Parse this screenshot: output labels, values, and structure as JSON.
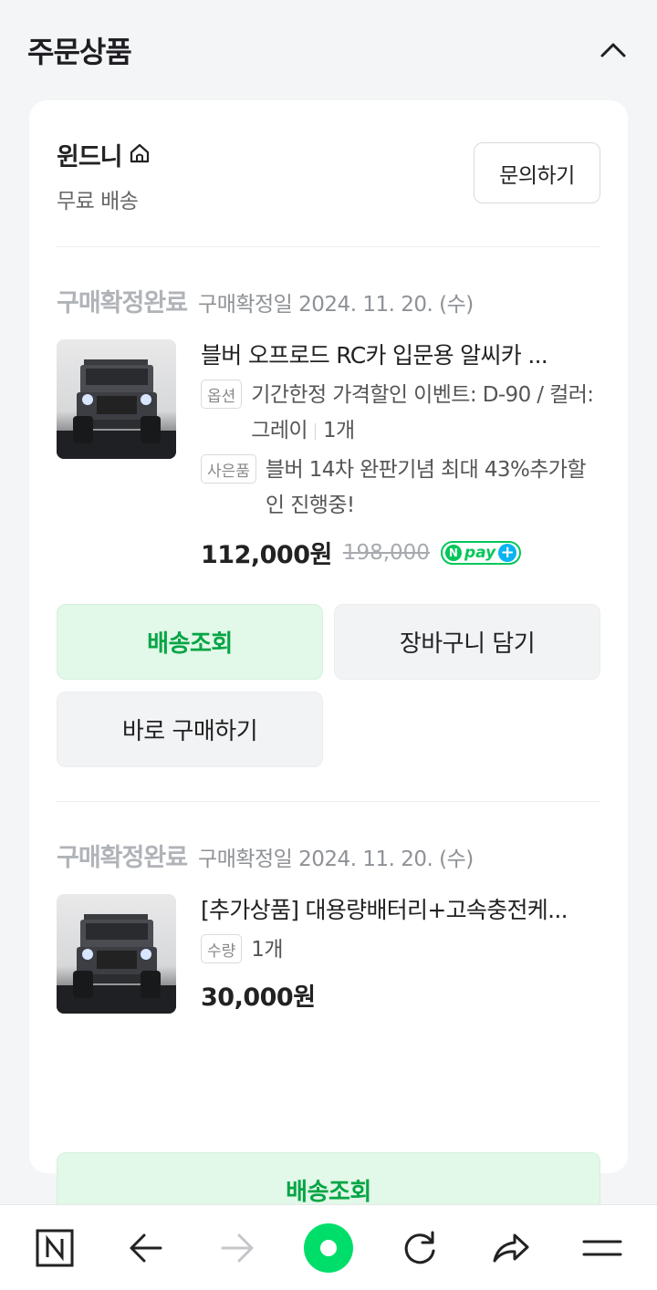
{
  "section": {
    "title": "주문상품"
  },
  "seller": {
    "name": "윈드니",
    "shipping": "무료 배송",
    "inquiry_label": "문의하기"
  },
  "orders": [
    {
      "status": "구매확정완료",
      "confirm_date": "구매확정일 2024. 11. 20. (수)",
      "product_title": "블버 오프로드 RC카 입문용 알씨카 ...",
      "option_tag": "옵션",
      "option_text": "기간한정 가격할인 이벤트: D-90 / 컬러: 그레이",
      "quantity": "1개",
      "gift_tag": "사은품",
      "gift_text": "블버 14차 완판기념 최대 43%추가할인 진행중!",
      "price": "112,000원",
      "original_price": "198,000",
      "npay_badge": {
        "n": "N",
        "pay": "pay",
        "plus": "+"
      },
      "buttons": {
        "track": "배송조회",
        "cart": "장바구니 담기",
        "buy_again": "바로 구매하기"
      }
    },
    {
      "status": "구매확정완료",
      "confirm_date": "구매확정일 2024. 11. 20. (수)",
      "product_title": "[추가상품] 대용량배터리+고속충전케...",
      "quantity_tag": "수량",
      "quantity": "1개",
      "price": "30,000원",
      "buttons": {
        "track": "배송조회"
      }
    }
  ],
  "bottom_nav": {
    "items": [
      "naver-home-icon",
      "back-arrow-icon",
      "forward-arrow-icon",
      "green-dot-icon",
      "refresh-icon",
      "share-icon",
      "menu-icon"
    ]
  },
  "colors": {
    "accent": "#03c75a",
    "track_button_bg": "#e2f8e8",
    "track_button_text": "#05a545"
  }
}
